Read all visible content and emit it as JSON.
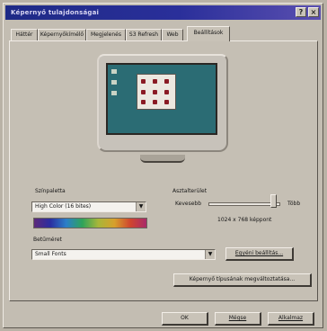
{
  "window": {
    "title": "Képernyő tulajdonságai",
    "close_glyph": "×",
    "help_glyph": "?"
  },
  "tabs": [
    {
      "label": "Háttér"
    },
    {
      "label": "Képernyőkímélő"
    },
    {
      "label": "Megjelenés"
    },
    {
      "label": "S3 Refresh"
    },
    {
      "label": "Web"
    },
    {
      "label": "Beállítások",
      "active": true
    }
  ],
  "colors_group": {
    "label": "Színpaletta",
    "selected": "High Color (16 bites)"
  },
  "resolution_group": {
    "label": "Asztalterület",
    "min_label": "Kevesebb",
    "max_label": "Több",
    "value_text": "1024 x 768 képpont",
    "slider_level": 0.85
  },
  "font_group": {
    "label": "Betűméret",
    "selected": "Small Fonts"
  },
  "buttons": {
    "custom": "Egyéni beállítás...",
    "advanced": "Képernyő típusának megváltoztatása...",
    "ok": "OK",
    "cancel": "Mégse",
    "apply": "Alkalmaz"
  },
  "accent_colors": {
    "titlebar": "#1e2a86",
    "desktop": "#2b6c74"
  }
}
